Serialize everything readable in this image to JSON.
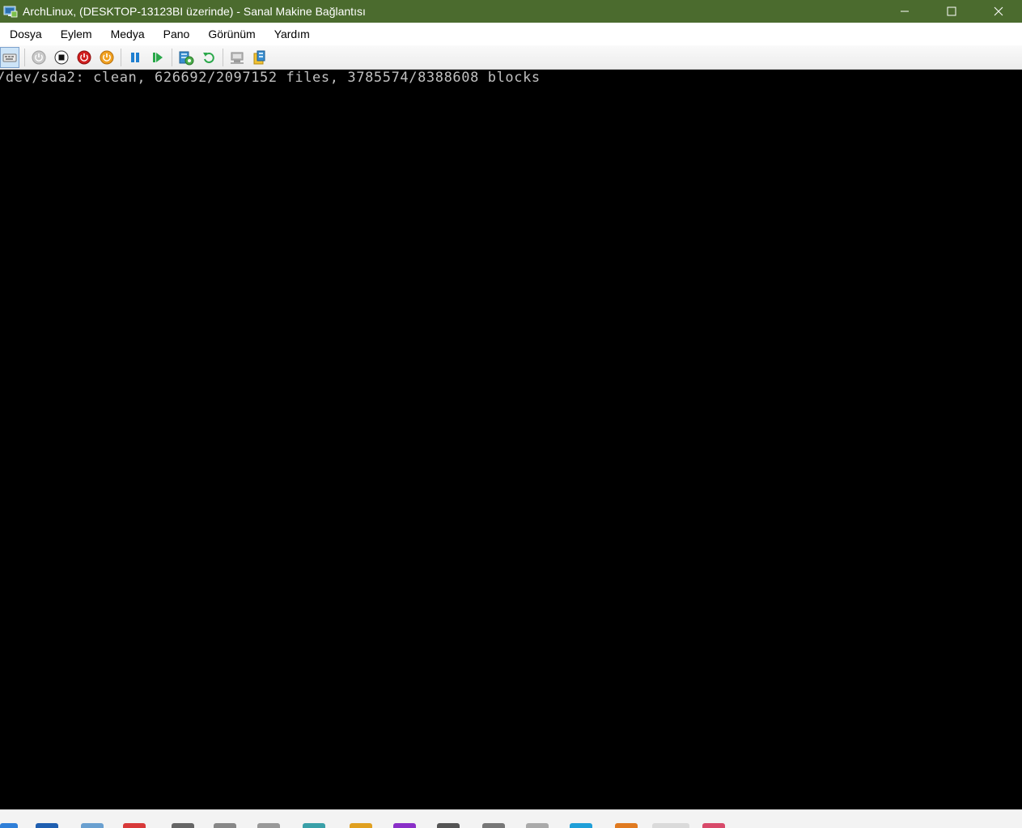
{
  "window": {
    "title": "ArchLinux, (DESKTOP-13123BI üzerinde) - Sanal Makine Bağlantısı",
    "titlebar_color": "#4b6b2e"
  },
  "menu": {
    "items": [
      "Dosya",
      "Eylem",
      "Medya",
      "Pano",
      "Görünüm",
      "Yardım"
    ]
  },
  "toolbar": {
    "buttons": [
      {
        "name": "ctrl-alt-del-icon"
      },
      {
        "name": "start-icon"
      },
      {
        "name": "turn-off-icon"
      },
      {
        "name": "shut-down-icon"
      },
      {
        "name": "save-icon"
      },
      {
        "name": "pause-icon"
      },
      {
        "name": "resume-icon"
      },
      {
        "name": "checkpoint-icon"
      },
      {
        "name": "revert-icon"
      },
      {
        "name": "enhanced-session-icon"
      },
      {
        "name": "share-icon"
      }
    ]
  },
  "console": {
    "lines": [
      "/dev/sda2: clean, 626692/2097152 files, 3785574/8388608 blocks"
    ]
  }
}
